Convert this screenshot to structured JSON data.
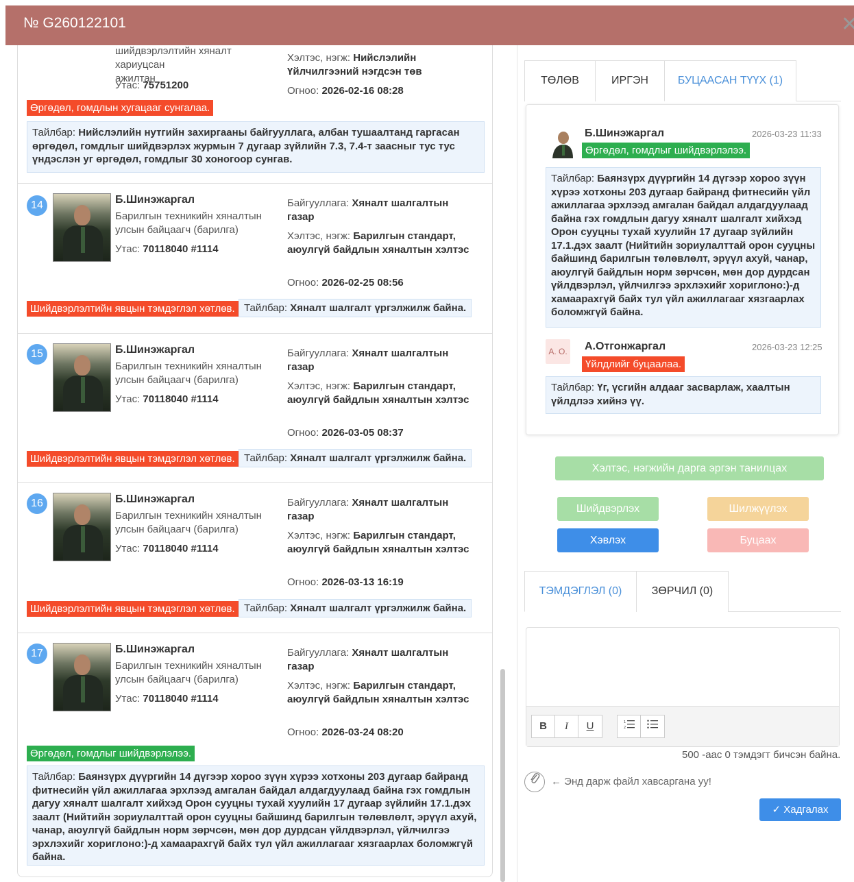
{
  "header": {
    "title": "№ G260122101",
    "close": "✕"
  },
  "top_card": {
    "role_partial": "шийдвэрлэлтийн хяналт хариуцсан",
    "role_rest": "ажилтан",
    "phone_label": "Утас:",
    "phone": "75751200",
    "unit_label": "Хэлтэс, нэгж:",
    "unit": "Нийслэлийн Үйлчилгээний нэгдсэн төв",
    "date_label": "Огноо:",
    "date": "2026-02-16 08:28",
    "status": "Өргөдөл, гомдлын хугацааг сунгалаа.",
    "note_label": "Тайлбар:",
    "note": "Нийслэлийн нутгийн захиргааны байгууллага, албан тушаалтанд гаргасан өргөдөл, гомдлыг шийдвэрлэх журмын 7 дугаар зүйлийн 7.3, 7.4-т заасныг тус тус үндэслэн уг өргөдөл, гомдлыг 30 хоногоор сунгав."
  },
  "entries": [
    {
      "num": "14",
      "name": "Б.Шинэжаргал",
      "position": "Барилгын техникийн хяналтын улсын байцаагч (барилга)",
      "phone_label": "Утас:",
      "phone": "70118040 #1114",
      "org_label": "Байгууллага:",
      "org": "Хяналт шалгалтын газар",
      "unit_label": "Хэлтэс, нэгж:",
      "unit": "Барилгын стандарт, аюулгүй байдлын хяналтын хэлтэс",
      "date_label": "Огноо:",
      "date": "2026-02-25 08:56",
      "status": "Шийдвэрлэлтийн явцын тэмдэглэл хөтлөв.",
      "note_label": "Тайлбар:",
      "note": "Хяналт шалгалт үргэлжилж байна."
    },
    {
      "num": "15",
      "name": "Б.Шинэжаргал",
      "position": "Барилгын техникийн хяналтын улсын байцаагч (барилга)",
      "phone_label": "Утас:",
      "phone": "70118040 #1114",
      "org_label": "Байгууллага:",
      "org": "Хяналт шалгалтын газар",
      "unit_label": "Хэлтэс, нэгж:",
      "unit": "Барилгын стандарт, аюулгүй байдлын хяналтын хэлтэс",
      "date_label": "Огноо:",
      "date": "2026-03-05 08:37",
      "status": "Шийдвэрлэлтийн явцын тэмдэглэл хөтлөв.",
      "note_label": "Тайлбар:",
      "note": "Хяналт шалгалт үргэлжилж байна."
    },
    {
      "num": "16",
      "name": "Б.Шинэжаргал",
      "position": "Барилгын техникийн хяналтын улсын байцаагч (барилга)",
      "phone_label": "Утас:",
      "phone": "70118040 #1114",
      "org_label": "Байгууллага:",
      "org": "Хяналт шалгалтын газар",
      "unit_label": "Хэлтэс, нэгж:",
      "unit": "Барилгын стандарт, аюулгүй байдлын хяналтын хэлтэс",
      "date_label": "Огноо:",
      "date": "2026-03-13 16:19",
      "status": "Шийдвэрлэлтийн явцын тэмдэглэл хөтлөв.",
      "note_label": "Тайлбар:",
      "note": "Хяналт шалгалт үргэлжилж байна."
    },
    {
      "num": "17",
      "name": "Б.Шинэжаргал",
      "position": "Барилгын техникийн хяналтын улсын байцаагч (барилга)",
      "phone_label": "Утас:",
      "phone": "70118040 #1114",
      "org_label": "Байгууллага:",
      "org": "Хяналт шалгалтын газар",
      "unit_label": "Хэлтэс, нэгж:",
      "unit": "Барилгын стандарт, аюулгүй байдлын хяналтын хэлтэс",
      "date_label": "Огноо:",
      "date": "2026-03-24 08:20",
      "status": "Өргөдөл, гомдлыг шийдвэрлэлээ.",
      "note_label": "Тайлбар:",
      "note": "Баянзүрх дүүргийн 14 дүгээр хороо зүүн хүрээ хотхоны 203 дугаар байранд фитнесийн үйл ажиллагаа эрхлээд амгалан байдал алдагдуулаад байна гэх гомдлын дагуу хяналт шалгалт хийхэд Орон сууцны тухай хуулийн 17 дугаар зүйлийн 17.1.дэх заалт (Нийтийн зориулалттай орон сууцны байшинд барилгын төлөвлөлт, эрүүл ахуй, чанар, аюулгүй байдлын норм зөрчсөн, мөн дор дурдсан үйлдвэрлэл, үйлчилгээ эрхлэхийг хориглоно:)-д хамаарахгүй байх тул үйл ажиллагааг хязгаарлах боломжгүй байна."
    }
  ],
  "right_tabs": [
    {
      "label": "ТӨЛӨВ"
    },
    {
      "label": "ИРГЭН"
    },
    {
      "label": "БУЦААСАН ТҮҮХ (1)"
    }
  ],
  "history": [
    {
      "name": "Б.Шинэжаргал",
      "time": "2026-03-23 11:33",
      "status": "Өргөдөл, гомдлыг шийдвэрлэлээ.",
      "note_label": "Тайлбар:",
      "note": "Баянзүрх дүүргийн 14 дүгээр хороо зүүн хүрээ хотхоны 203 дугаар байранд фитнесийн үйл ажиллагаа эрхлээд амгалан байдал алдагдуулаад байна гэх гомдлын дагуу хяналт шалгалт хийхэд Орон сууцны тухай хуулийн 17 дугаар зүйлийн 17.1.дэх заалт (Нийтийн зориулалттай орон сууцны байшинд барилгын төлөвлөлт, эрүүл ахуй, чанар, аюулгүй байдлын норм зөрчсөн, мөн дор дурдсан үйлдвэрлэл, үйлчилгээ эрхлэхийг хориглоно:)-д хамаарахгүй байх тул үйл ажиллагааг хязгаарлах боломжгүй байна."
    },
    {
      "initials": "А. О.",
      "name": "А.Отгонжаргал",
      "time": "2026-03-23 12:25",
      "status": "Үйлдлийг буцаалаа.",
      "note_label": "Тайлбар:",
      "note": "Үг, үсгийн алдааг засварлаж, хаалтын үйлдлээ хийнэ үү."
    }
  ],
  "actions": {
    "head_review": "Хэлтэс, нэгжийн дарга эргэн танилцах",
    "resolve": "Шийдвэрлэх",
    "transfer": "Шилжүүлэх",
    "register": "Хэвлэх",
    "return": "Буцаах"
  },
  "bottom_tabs": [
    {
      "label": "ТЭМДЭГЛЭЛ (0)"
    },
    {
      "label": "ЗӨРЧИЛ (0)"
    }
  ],
  "editor": {
    "toolbar": [
      "B",
      "I",
      "U",
      "ordered-list",
      "bullet-list"
    ],
    "char_count": "500 -аас 0 тэмдэгт бичсэн байна."
  },
  "attachment": {
    "text": "← Энд дарж файл хавсаргана уу!"
  },
  "save_button": "✓ Хадгалах",
  "colors": {
    "header_bg": "#b5706a",
    "red_label": "#f44b2a",
    "green_label": "#2dae4f",
    "primary": "#3e8ee8",
    "num_badge": "#5ea8f0"
  }
}
